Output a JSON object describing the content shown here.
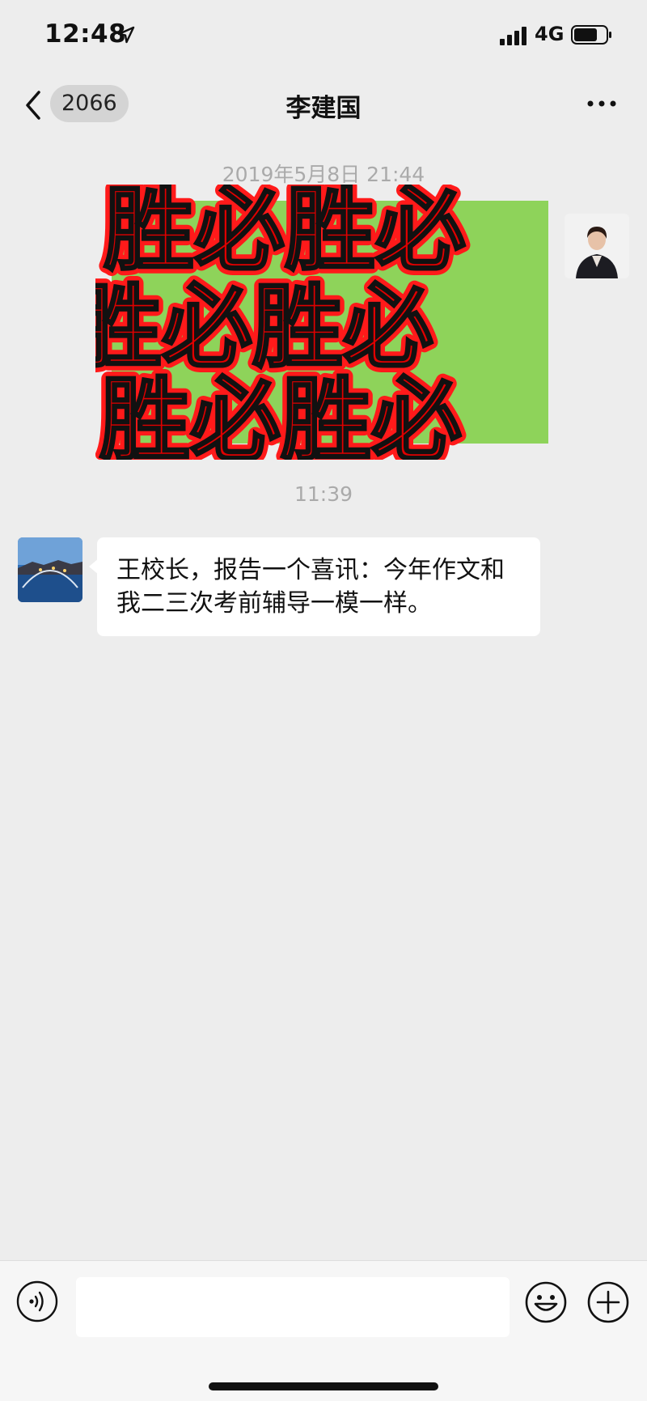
{
  "status_bar": {
    "time": "12:48",
    "network": "4G",
    "icons": [
      "location-arrow-icon",
      "signal-icon",
      "battery-icon"
    ]
  },
  "nav": {
    "back_icon": "chevron-left-icon",
    "unread_count": "2066",
    "title": "李建国",
    "more_icon": "more-dots-icon"
  },
  "messages": {
    "timestamp_1": "2019年5月8日 21:44",
    "sticker_text": "胜必胜必",
    "timestamp_2": "11:39",
    "text_message": "王校长，报告一个喜讯：今年作文和我二三次考前辅导一模一样。"
  },
  "input_bar": {
    "voice_icon": "voice-icon",
    "emoji_icon": "smiley-icon",
    "plus_icon": "plus-circle-icon"
  },
  "colors": {
    "background": "#ededed",
    "sticker_red": "#ff1a1a",
    "sticker_green": "#8ed35a",
    "bubble": "#ffffff"
  }
}
